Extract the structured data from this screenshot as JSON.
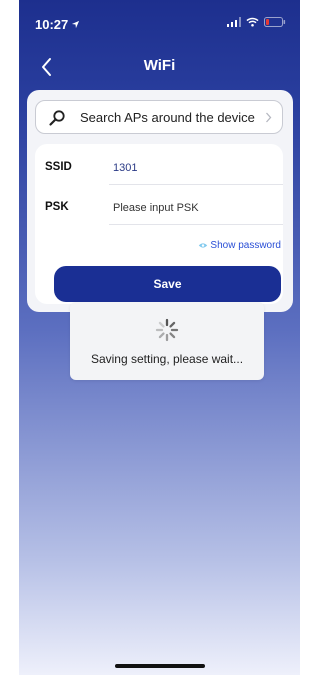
{
  "status_bar": {
    "time": "10:27"
  },
  "nav": {
    "title": "WiFi"
  },
  "search": {
    "label": "Search APs around the device"
  },
  "form": {
    "ssid_label": "SSID",
    "ssid_value": "1301",
    "psk_label": "PSK",
    "psk_placeholder": "Please input PSK",
    "show_password": "Show password"
  },
  "save_button": {
    "label": "Save"
  },
  "toast": {
    "message": "Saving setting, please wait..."
  },
  "colors": {
    "primary": "#1a2f94",
    "link": "#2a4fd6",
    "battery_low": "#e53935"
  },
  "icons": [
    "location-arrow-icon",
    "signal-icon",
    "wifi-icon",
    "battery-icon",
    "back-chevron-icon",
    "search-icon",
    "chevron-right-icon",
    "eye-icon",
    "spinner-icon"
  ]
}
